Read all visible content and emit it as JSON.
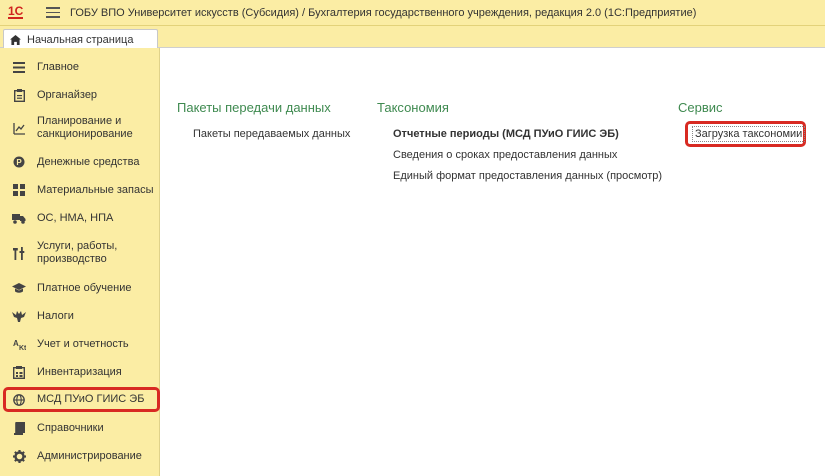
{
  "titlebar": {
    "logo": "1С",
    "title": "ГОБУ ВПО Университет искусств (Субсидия) / Бухгалтерия государственного учреждения, редакция 2.0  (1С:Предприятие)"
  },
  "tabs": [
    {
      "label": "Начальная страница",
      "icon": "home-icon"
    }
  ],
  "sidebar": {
    "items": [
      {
        "label": "Главное",
        "icon": "menu-lines-icon"
      },
      {
        "label": "Органайзер",
        "icon": "clipboard-icon"
      },
      {
        "label": "Планирование и санкционирование",
        "icon": "planning-chart-icon"
      },
      {
        "label": "Денежные средства",
        "icon": "coin-icon"
      },
      {
        "label": "Материальные запасы",
        "icon": "grid-blocks-icon"
      },
      {
        "label": "ОС, НМА, НПА",
        "icon": "truck-icon"
      },
      {
        "label": "Услуги, работы, производство",
        "icon": "tools-icon"
      },
      {
        "label": "Платное обучение",
        "icon": "graduation-cap-icon"
      },
      {
        "label": "Налоги",
        "icon": "eagle-icon"
      },
      {
        "label": "Учет и отчетность",
        "icon": "accounting-icon"
      },
      {
        "label": "Инвентаризация",
        "icon": "inventory-icon"
      },
      {
        "label": "МСД ПУиО ГИИС ЭБ",
        "icon": "globe-icon"
      },
      {
        "label": "Справочники",
        "icon": "book-icon"
      },
      {
        "label": "Администрирование",
        "icon": "gear-icon"
      }
    ]
  },
  "main": {
    "packages": {
      "title": "Пакеты передачи данных",
      "links": [
        "Пакеты передаваемых данных"
      ]
    },
    "taxonomy": {
      "title": "Таксономия",
      "links": [
        "Отчетные периоды (МСД ПУиО ГИИС ЭБ)",
        "Сведения о сроках предоставления данных",
        "Единый формат предоставления данных (просмотр)"
      ]
    },
    "service": {
      "title": "Сервис",
      "links": [
        "Загрузка таксономии"
      ]
    }
  },
  "colors": {
    "panel_bg": "#fbeda4",
    "section_title": "#3f8a50",
    "highlight": "#d82a22",
    "logo": "#d0241f"
  }
}
